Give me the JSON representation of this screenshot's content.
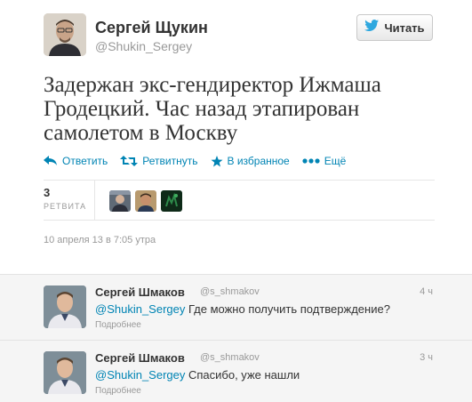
{
  "author": {
    "name": "Сергей Щукин",
    "handle": "@Shukin_Sergey"
  },
  "follow_button": {
    "label": "Читать",
    "icon": "twitter-bird-icon"
  },
  "tweet": {
    "text": "Задержан экс-гендиректор Ижмаша Гродецкий. Час назад этапирован самолетом в Москву",
    "timestamp": "10 апреля 13 в 7:05 утра"
  },
  "actions": {
    "reply": "Ответить",
    "retweet": "Ретвитнуть",
    "favorite": "В избранное",
    "more": "Ещё"
  },
  "stats": {
    "retweet_count": "3",
    "retweet_label": "РЕТВИТА"
  },
  "replies": [
    {
      "name": "Сергей Шмаков",
      "handle": "@s_shmakov",
      "time": "4 ч",
      "mention": "@Shukin_Sergey",
      "text": " Где можно получить подтверждение?",
      "more": "Подробнее"
    },
    {
      "name": "Сергей Шмаков",
      "handle": "@s_shmakov",
      "time": "3 ч",
      "mention": "@Shukin_Sergey",
      "text": " Спасибо, уже нашли",
      "more": "Подробнее"
    }
  ],
  "colors": {
    "link": "#0084b4",
    "muted": "#999999",
    "text": "#333333",
    "twitter_blue": "#2fa8df"
  }
}
